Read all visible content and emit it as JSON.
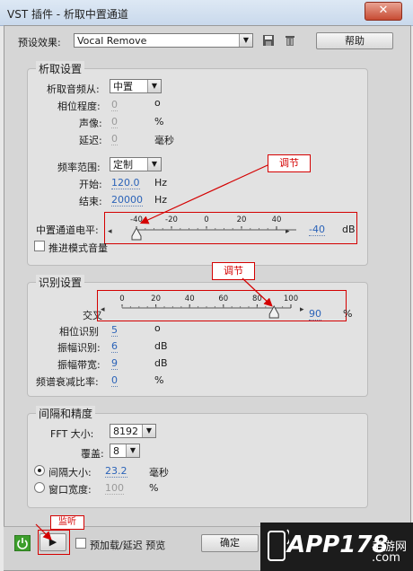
{
  "window": {
    "title": "VST 插件 - 析取中置通道",
    "close_glyph": "✕"
  },
  "preset": {
    "label": "预设效果:",
    "value": "Vocal Remove",
    "help": "帮助"
  },
  "extract": {
    "title": "析取设置",
    "source_label": "析取音频从:",
    "source_value": "中置",
    "phase_label": "相位程度:",
    "phase_value": "0",
    "phase_unit": "o",
    "pan_label": "声像:",
    "pan_value": "0",
    "pan_unit": "%",
    "delay_label": "延迟:",
    "delay_value": "0",
    "delay_unit": "毫秒",
    "freq_label": "频率范围:",
    "freq_value": "定制",
    "start_label": "开始:",
    "start_value": "120.0",
    "start_unit": "Hz",
    "end_label": "结束:",
    "end_value": "20000",
    "end_unit": "Hz",
    "center_label": "中置通道电平:",
    "center_ticks": [
      "-40",
      "-20",
      "0",
      "20",
      "40"
    ],
    "center_value": "-40",
    "center_unit": "dB",
    "center_level": 0.0,
    "boost_label": "推进模式音量"
  },
  "discrim": {
    "title": "识别设置",
    "cross_label": "交叉",
    "cross_ticks": [
      "0",
      "20",
      "40",
      "60",
      "80",
      "100"
    ],
    "cross_value": "90",
    "cross_unit": "%",
    "cross_level": 0.9,
    "phase_label": "相位识别",
    "phase_value": "5",
    "phase_unit": "o",
    "amp_label": "振幅识别:",
    "amp_value": "6",
    "amp_unit": "dB",
    "ampbw_label": "振幅带宽:",
    "ampbw_value": "9",
    "ampbw_unit": "dB",
    "spec_label": "频谱衰减比率:",
    "spec_value": "0",
    "spec_unit": "%"
  },
  "spacing": {
    "title": "间隔和精度",
    "fft_label": "FFT 大小:",
    "fft_value": "8192",
    "overlap_label": "覆盖:",
    "overlap_value": "8",
    "interval_label": "间隔大小:",
    "interval_value": "23.2",
    "interval_unit": "毫秒",
    "window_label": "窗口宽度:",
    "window_value": "100",
    "window_unit": "%"
  },
  "annotations": {
    "adjust1": "调节",
    "adjust2": "调节",
    "listen": "监听"
  },
  "bottom": {
    "preload_label": "预加载/延迟 预览",
    "ok": "确定"
  },
  "logo": {
    "brand": "APP178",
    "suffix": "手游网",
    "domain": ".com"
  }
}
